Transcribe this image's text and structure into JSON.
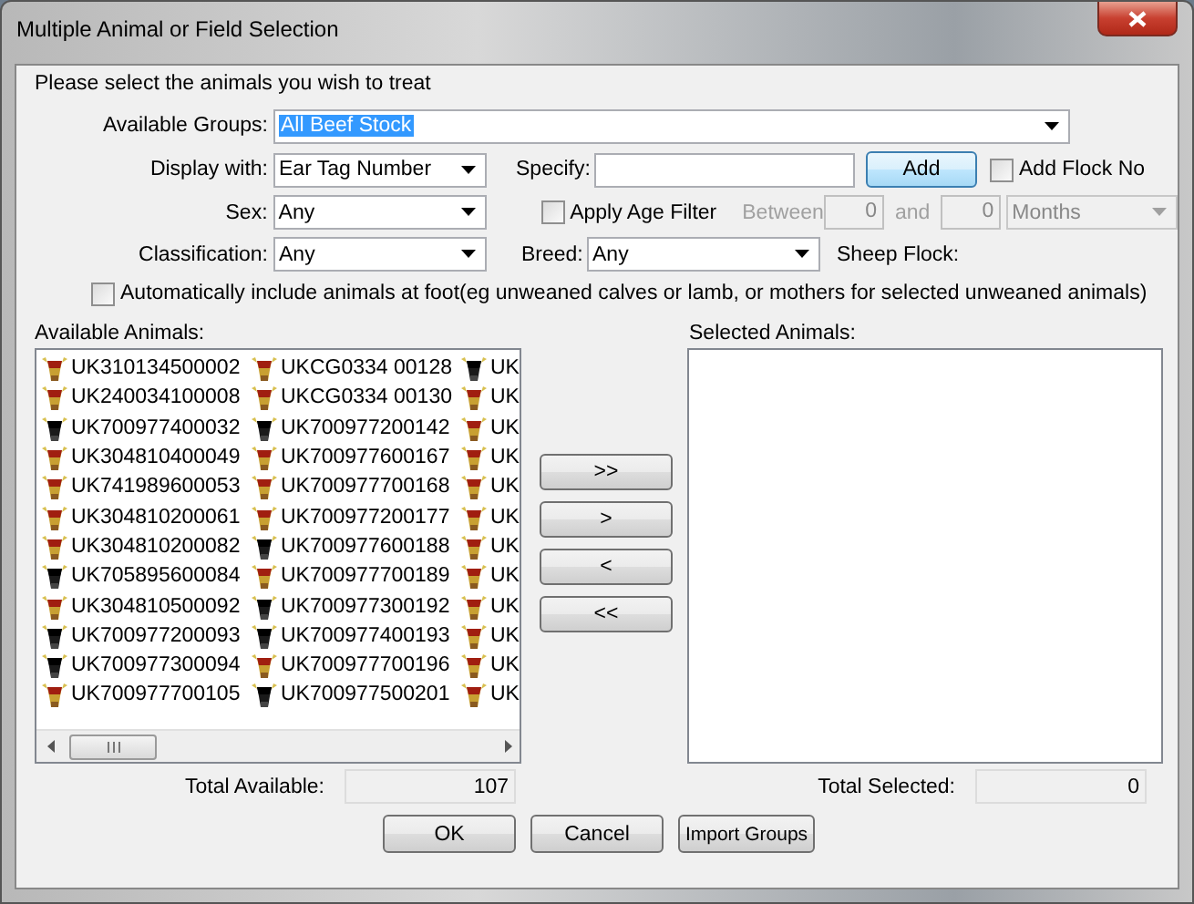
{
  "window": {
    "title": "Multiple Animal or Field Selection"
  },
  "instruction": "Please select the animals you wish to treat",
  "available_groups": {
    "label": "Available Groups:",
    "value": "All Beef Stock",
    "highlighted": true
  },
  "display_with": {
    "label": "Display with:",
    "value": "Ear Tag Number"
  },
  "specify": {
    "label": "Specify:"
  },
  "add_button": "Add",
  "add_flock_no": {
    "label": "Add Flock No",
    "checked": false
  },
  "sex": {
    "label": "Sex:",
    "value": "Any"
  },
  "apply_age_filter": {
    "label": "Apply Age Filter",
    "checked": false
  },
  "age_range": {
    "between_label": "Between",
    "from": "0",
    "and_label": "and",
    "to": "0",
    "unit": "Months",
    "disabled": true
  },
  "classification": {
    "label": "Classification:",
    "value": "Any"
  },
  "breed": {
    "label": "Breed:",
    "value": "Any"
  },
  "sheep_flock": {
    "label": "Sheep Flock:"
  },
  "include_at_foot": {
    "label": "Automatically include animals at foot(eg unweaned calves or lamb, or mothers for selected unweaned animals)",
    "checked": false
  },
  "available_animals": {
    "label": "Available Animals:",
    "columns": [
      [
        {
          "tag": "UK310134500002",
          "kind": "brown"
        },
        {
          "tag": "UK240034100008",
          "kind": "brown"
        },
        {
          "tag": "UK700977400032",
          "kind": "black"
        },
        {
          "tag": "UK304810400049",
          "kind": "brown"
        },
        {
          "tag": "UK741989600053",
          "kind": "brown"
        },
        {
          "tag": "UK304810200061",
          "kind": "brown"
        },
        {
          "tag": "UK304810200082",
          "kind": "brown"
        },
        {
          "tag": "UK705895600084",
          "kind": "black"
        },
        {
          "tag": "UK304810500092",
          "kind": "brown"
        },
        {
          "tag": "UK700977200093",
          "kind": "black"
        },
        {
          "tag": "UK700977300094",
          "kind": "black"
        },
        {
          "tag": "UK700977700105",
          "kind": "brown"
        }
      ],
      [
        {
          "tag": "UKCG0334 00128",
          "kind": "brown"
        },
        {
          "tag": "UKCG0334 00130",
          "kind": "brown"
        },
        {
          "tag": "UK700977200142",
          "kind": "black"
        },
        {
          "tag": "UK700977600167",
          "kind": "brown"
        },
        {
          "tag": "UK700977700168",
          "kind": "brown"
        },
        {
          "tag": "UK700977200177",
          "kind": "brown"
        },
        {
          "tag": "UK700977600188",
          "kind": "black"
        },
        {
          "tag": "UK700977700189",
          "kind": "brown"
        },
        {
          "tag": "UK700977300192",
          "kind": "black"
        },
        {
          "tag": "UK700977400193",
          "kind": "black"
        },
        {
          "tag": "UK700977700196",
          "kind": "brown"
        },
        {
          "tag": "UK700977500201",
          "kind": "black"
        }
      ],
      [
        {
          "tag": "UK",
          "kind": "black"
        },
        {
          "tag": "UK",
          "kind": "brown"
        },
        {
          "tag": "UK",
          "kind": "brown"
        },
        {
          "tag": "UK",
          "kind": "brown"
        },
        {
          "tag": "UK",
          "kind": "brown"
        },
        {
          "tag": "UK",
          "kind": "brown"
        },
        {
          "tag": "UK",
          "kind": "brown"
        },
        {
          "tag": "UK",
          "kind": "brown"
        },
        {
          "tag": "UK",
          "kind": "brown"
        },
        {
          "tag": "UK",
          "kind": "brown"
        },
        {
          "tag": "UK",
          "kind": "brown"
        },
        {
          "tag": "UK",
          "kind": "brown"
        }
      ]
    ]
  },
  "move_buttons": [
    ">>",
    ">",
    "<",
    "<<"
  ],
  "selected_animals": {
    "label": "Selected Animals:"
  },
  "total_available": {
    "label": "Total Available:",
    "value": "107"
  },
  "total_selected": {
    "label": "Total Selected:",
    "value": "0"
  },
  "buttons": [
    "OK",
    "Cancel",
    "Import Groups"
  ]
}
